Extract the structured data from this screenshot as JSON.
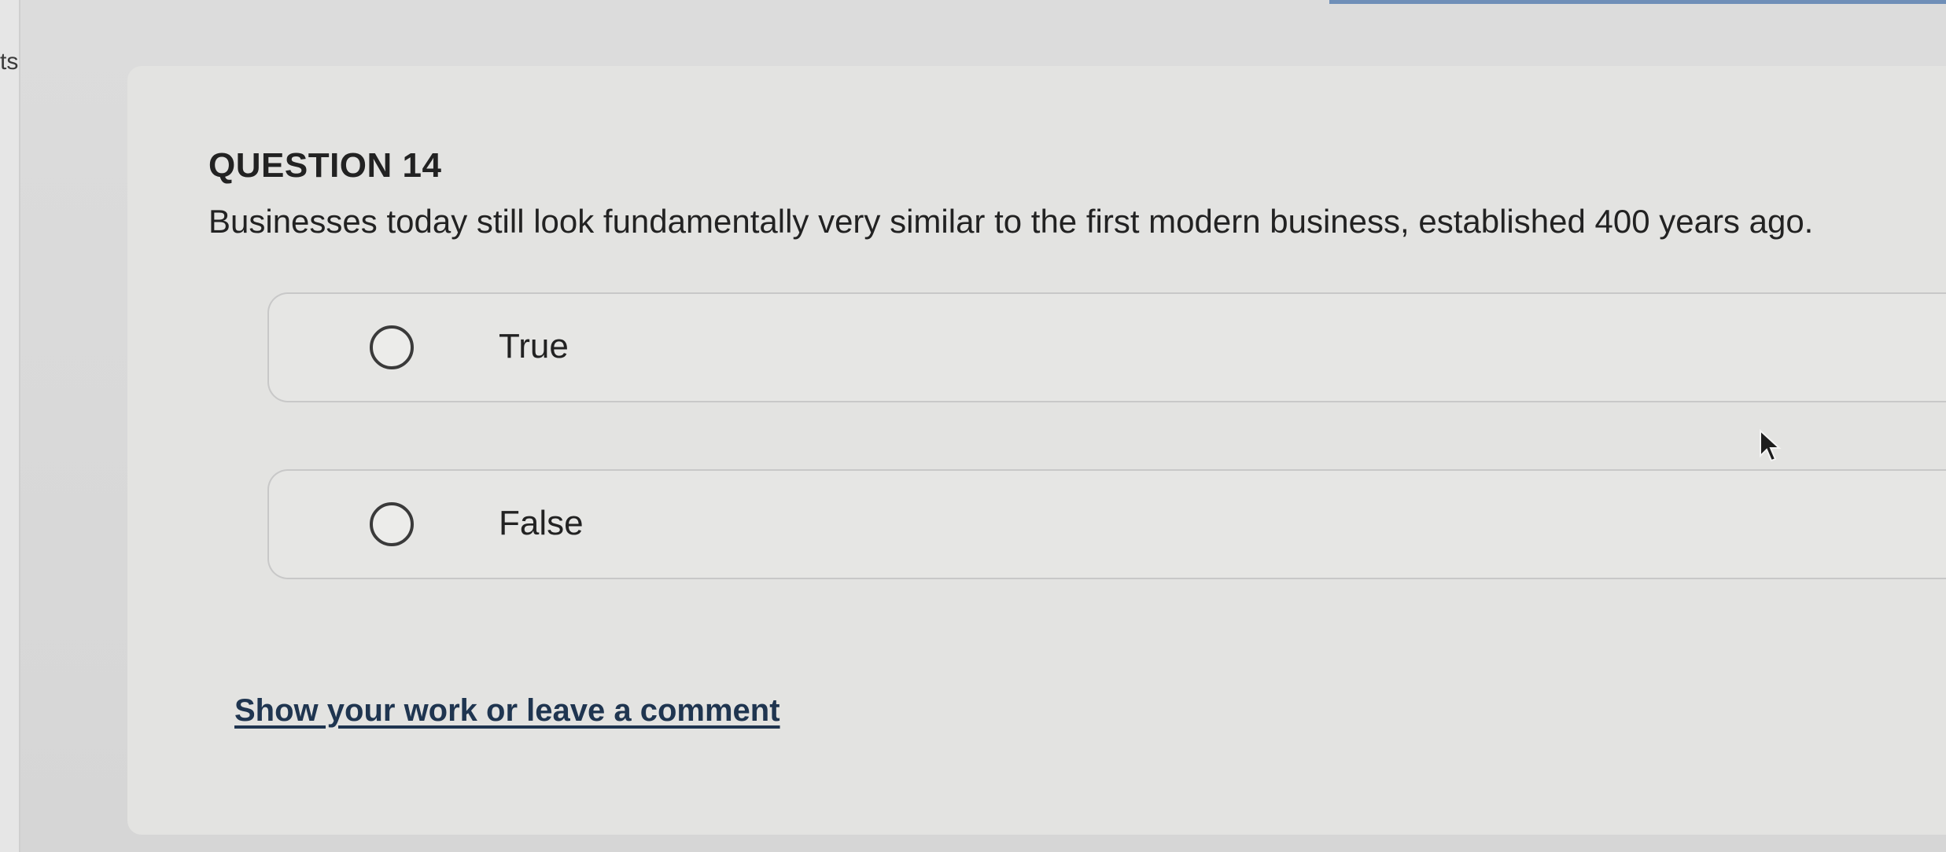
{
  "sidebar": {
    "fragment_text": "ts"
  },
  "question": {
    "title": "QUESTION 14",
    "text": "Businesses today still look fundamentally very similar to the first modern business, established 400 years ago.",
    "options": [
      {
        "label": "True",
        "selected": false
      },
      {
        "label": "False",
        "selected": false
      }
    ]
  },
  "comment": {
    "link_label": "Show your work or leave a comment"
  },
  "icons": {
    "radio": "radio-unchecked-icon",
    "cursor": "mouse-cursor-icon"
  },
  "colors": {
    "link": "#1f3550",
    "accent": "#6f8fb8"
  }
}
